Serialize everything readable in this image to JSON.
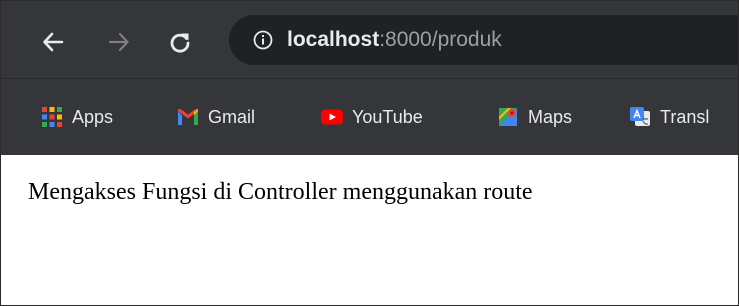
{
  "browser": {
    "address": {
      "host": "localhost",
      "rest": ":8000/produk"
    },
    "bookmarks": [
      {
        "label": "Apps",
        "icon": "apps-grid-icon"
      },
      {
        "label": "Gmail",
        "icon": "gmail-icon"
      },
      {
        "label": "YouTube",
        "icon": "youtube-icon"
      },
      {
        "label": "Maps",
        "icon": "maps-icon"
      },
      {
        "label": "Transl",
        "icon": "translate-icon"
      }
    ],
    "colors": {
      "toolbar": "#35363a",
      "omnibox": "#202124",
      "text_light": "#e8eaed",
      "text_dim": "#9aa0a6"
    }
  },
  "page": {
    "body_text": "Mengakses Fungsi di Controller menggunakan route"
  }
}
